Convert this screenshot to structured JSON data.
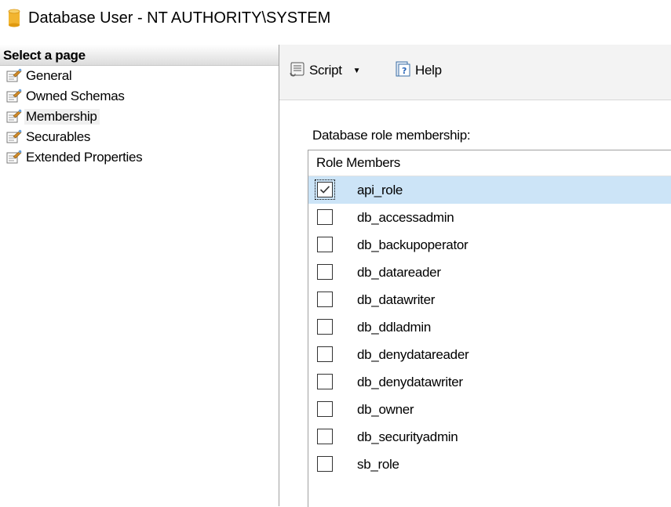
{
  "window": {
    "title": "Database User - NT AUTHORITY\\SYSTEM",
    "icon": "database-icon",
    "icon_color": "#f2b530"
  },
  "sidebar": {
    "header": "Select a page",
    "items": [
      {
        "label": "General",
        "icon": "page-wrench-icon",
        "selected": false
      },
      {
        "label": "Owned Schemas",
        "icon": "page-wrench-icon",
        "selected": false
      },
      {
        "label": "Membership",
        "icon": "page-wrench-icon",
        "selected": true
      },
      {
        "label": "Securables",
        "icon": "page-wrench-icon",
        "selected": false
      },
      {
        "label": "Extended Properties",
        "icon": "page-wrench-icon",
        "selected": false
      }
    ]
  },
  "toolbar": {
    "script_label": "Script",
    "help_label": "Help"
  },
  "main": {
    "section_label": "Database role membership:",
    "table": {
      "header": "Role Members",
      "rows": [
        {
          "name": "api_role",
          "checked": true,
          "selected": true
        },
        {
          "name": "db_accessadmin",
          "checked": false,
          "selected": false
        },
        {
          "name": "db_backupoperator",
          "checked": false,
          "selected": false
        },
        {
          "name": "db_datareader",
          "checked": false,
          "selected": false
        },
        {
          "name": "db_datawriter",
          "checked": false,
          "selected": false
        },
        {
          "name": "db_ddladmin",
          "checked": false,
          "selected": false
        },
        {
          "name": "db_denydatareader",
          "checked": false,
          "selected": false
        },
        {
          "name": "db_denydatawriter",
          "checked": false,
          "selected": false
        },
        {
          "name": "db_owner",
          "checked": false,
          "selected": false
        },
        {
          "name": "db_securityadmin",
          "checked": false,
          "selected": false
        },
        {
          "name": "sb_role",
          "checked": false,
          "selected": false
        }
      ]
    }
  },
  "colors": {
    "selection": "#cce4f7",
    "toolbar_bg": "#f3f3f3"
  }
}
